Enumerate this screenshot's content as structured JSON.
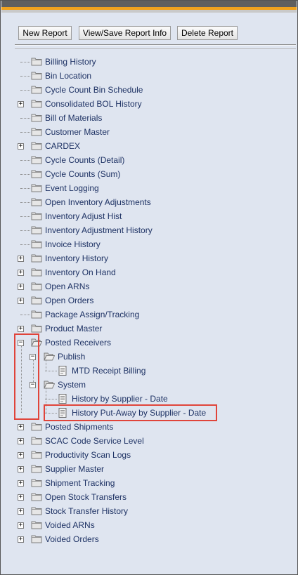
{
  "toolbar": {
    "new_report": "New Report",
    "view_save": "View/Save Report Info",
    "delete_report": "Delete Report"
  },
  "tree": {
    "billing_history": "Billing History",
    "bin_location": "Bin Location",
    "cycle_count_bin_schedule": "Cycle Count Bin Schedule",
    "consolidated_bol_history": "Consolidated BOL History",
    "bill_of_materials": "Bill of Materials",
    "customer_master": "Customer Master",
    "cardex": "CARDEX",
    "cycle_counts_detail": "Cycle Counts (Detail)",
    "cycle_counts_sum": "Cycle Counts (Sum)",
    "event_logging": "Event Logging",
    "open_inventory_adjustments": "Open Inventory Adjustments",
    "inventory_adjust_hist": "Inventory Adjust Hist",
    "inventory_adjustment_history": "Inventory Adjustment History",
    "invoice_history": "Invoice History",
    "inventory_history": "Inventory History",
    "inventory_on_hand": "Inventory On Hand",
    "open_arns": "Open ARNs",
    "open_orders": "Open Orders",
    "package_assign_tracking": "Package Assign/Tracking",
    "product_master": "Product Master",
    "posted_receivers": "Posted Receivers",
    "publish": "Publish",
    "mtd_receipt_billing": "MTD Receipt Billing",
    "system": "System",
    "history_by_supplier_date": "History by Supplier - Date",
    "history_putaway_by_supplier_date": "History Put-Away by Supplier - Date",
    "posted_shipments": "Posted Shipments",
    "scac_code_service_level": "SCAC Code Service Level",
    "productivity_scan_logs": "Productivity Scan Logs",
    "supplier_master": "Supplier Master",
    "shipment_tracking": "Shipment Tracking",
    "open_stock_transfers": "Open Stock Transfers",
    "stock_transfer_history": "Stock Transfer History",
    "voided_arns": "Voided ARNs",
    "voided_orders": "Voided Orders"
  },
  "glyphs": {
    "plus": "+",
    "minus": "−"
  },
  "colors": {
    "highlight": "#e0443a",
    "link_text": "#1e3264",
    "accent_orange": "#f0a21e"
  }
}
